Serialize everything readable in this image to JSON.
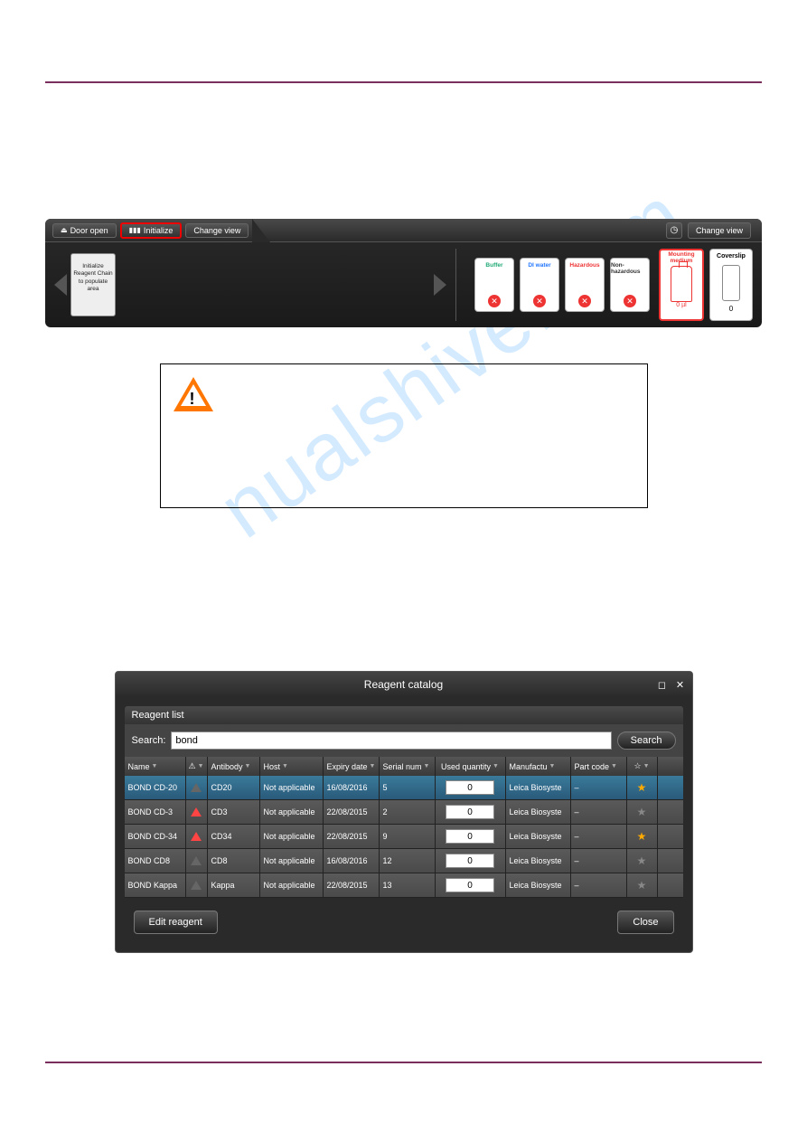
{
  "watermark": "nualshive.com",
  "toolbar": {
    "door_open": "Door open",
    "initialize": "Initialize",
    "change_view": "Change view",
    "change_view_r": "Change view",
    "init_box": "Initialize Reagent Chain to populate area",
    "bottles": [
      {
        "label": "Buffer",
        "color": "#2a7"
      },
      {
        "label": "DI water",
        "color": "#27f"
      },
      {
        "label": "Hazardous",
        "color": "#e33"
      },
      {
        "label": "Non-hazardous",
        "color": "#333"
      }
    ],
    "mounting": {
      "label": "Mounting medium",
      "value": "0",
      "unit": "µl"
    },
    "coverslip": {
      "label": "Coverslip",
      "value": "0"
    }
  },
  "dialog": {
    "title": "Reagent catalog",
    "section": "Reagent list",
    "search_label": "Search:",
    "search_value": "bond",
    "search_btn": "Search",
    "columns": [
      "Name",
      "",
      "Antibody",
      "Host",
      "Expiry date",
      "Serial num",
      "Used quantity",
      "Manufactu",
      "Part code",
      ""
    ],
    "rows": [
      {
        "name": "BOND CD-20",
        "warn": "gray",
        "antibody": "CD20",
        "host": "Not applicable",
        "expiry": "16/08/2016",
        "expiry_red": false,
        "serial": "5",
        "qty": "0",
        "mfr": "Leica Biosyste",
        "part": "–",
        "star": true,
        "sel": true
      },
      {
        "name": "BOND CD-3",
        "warn": "red",
        "antibody": "CD3",
        "host": "Not applicable",
        "expiry": "22/08/2015",
        "expiry_red": true,
        "serial": "2",
        "qty": "0",
        "mfr": "Leica Biosyste",
        "part": "–",
        "star": false,
        "sel": false
      },
      {
        "name": "BOND CD-34",
        "warn": "red",
        "antibody": "CD34",
        "host": "Not applicable",
        "expiry": "22/08/2015",
        "expiry_red": true,
        "serial": "9",
        "qty": "0",
        "mfr": "Leica Biosyste",
        "part": "–",
        "star": true,
        "sel": false
      },
      {
        "name": "BOND CD8",
        "warn": "gray",
        "antibody": "CD8",
        "host": "Not applicable",
        "expiry": "16/08/2016",
        "expiry_red": false,
        "serial": "12",
        "qty": "0",
        "mfr": "Leica Biosyste",
        "part": "–",
        "star": false,
        "sel": false
      },
      {
        "name": "BOND Kappa",
        "warn": "gray",
        "antibody": "Kappa",
        "host": "Not applicable",
        "expiry": "22/08/2015",
        "expiry_red": true,
        "serial": "13",
        "qty": "0",
        "mfr": "Leica Biosyste",
        "part": "–",
        "star": false,
        "sel": false
      }
    ],
    "edit_btn": "Edit reagent",
    "close_btn": "Close"
  }
}
